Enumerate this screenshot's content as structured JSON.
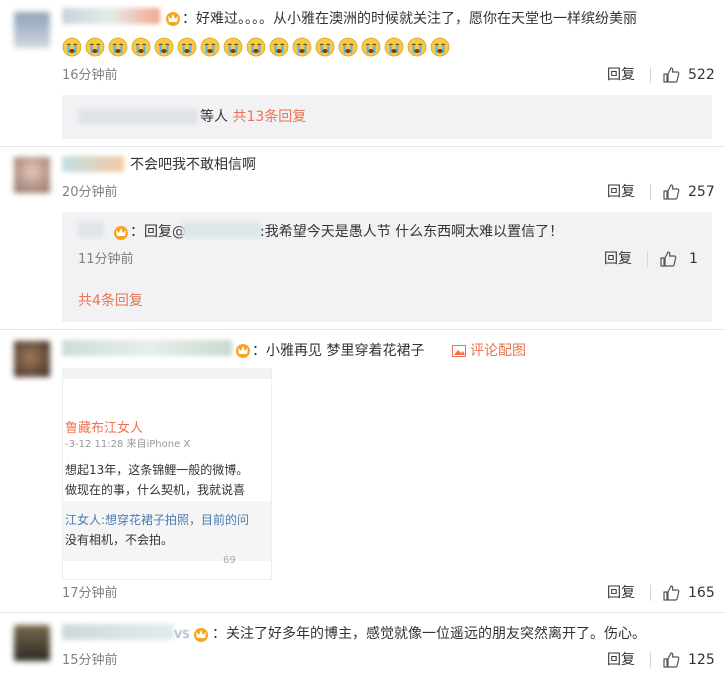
{
  "c1": {
    "text": "：好难过。。。。从小雅在澳洲的时候就关注了，愿你在天堂也一样缤纷美丽",
    "emoji_count": 17,
    "time": "16分钟前",
    "reply": "回复",
    "likes": "522",
    "summary_suffix": "等人",
    "summary_link": "共13条回复"
  },
  "c2": {
    "text": "不会吧我不敢相信啊",
    "time": "20分钟前",
    "reply": "回复",
    "likes": "257",
    "sub_prefix": "：回复@",
    "sub_text": ":我希望今天是愚人节 什么东西啊太难以置信了！",
    "sub_time": "11分钟前",
    "sub_reply": "回复",
    "sub_likes": "1",
    "more_link": "共4条回复"
  },
  "c3": {
    "text": "：小雅再见 梦里穿着花裙子",
    "pic_label": "评论配图",
    "time": "17分钟前",
    "reply": "回复",
    "likes": "165",
    "shot": {
      "author": "鲁藏布江女人",
      "meta": "-3-12 11:28 来自iPhone X",
      "line1": "想起13年，这条锦鲤一般的微博。",
      "line2": "做现在的事，什么契机，我就说喜",
      "line3": "江女人:想穿花裙子拍照，目前的问",
      "line4": "没有相机，不会拍。",
      "stat": "69"
    }
  },
  "c4": {
    "name_tail": "vs",
    "text": "关注了好多年的博主，感觉就像一位遥远的朋友突然离开了。伤心。",
    "time": "15分钟前",
    "reply": "回复",
    "likes": "125"
  },
  "colors": {
    "link": "#eb7350",
    "vip": "#f5a623",
    "reply_bg": "#f2f2f5"
  },
  "icons": [
    "vip-crown-icon",
    "like-thumb-icon",
    "crying-emoji-icon",
    "image-icon"
  ]
}
